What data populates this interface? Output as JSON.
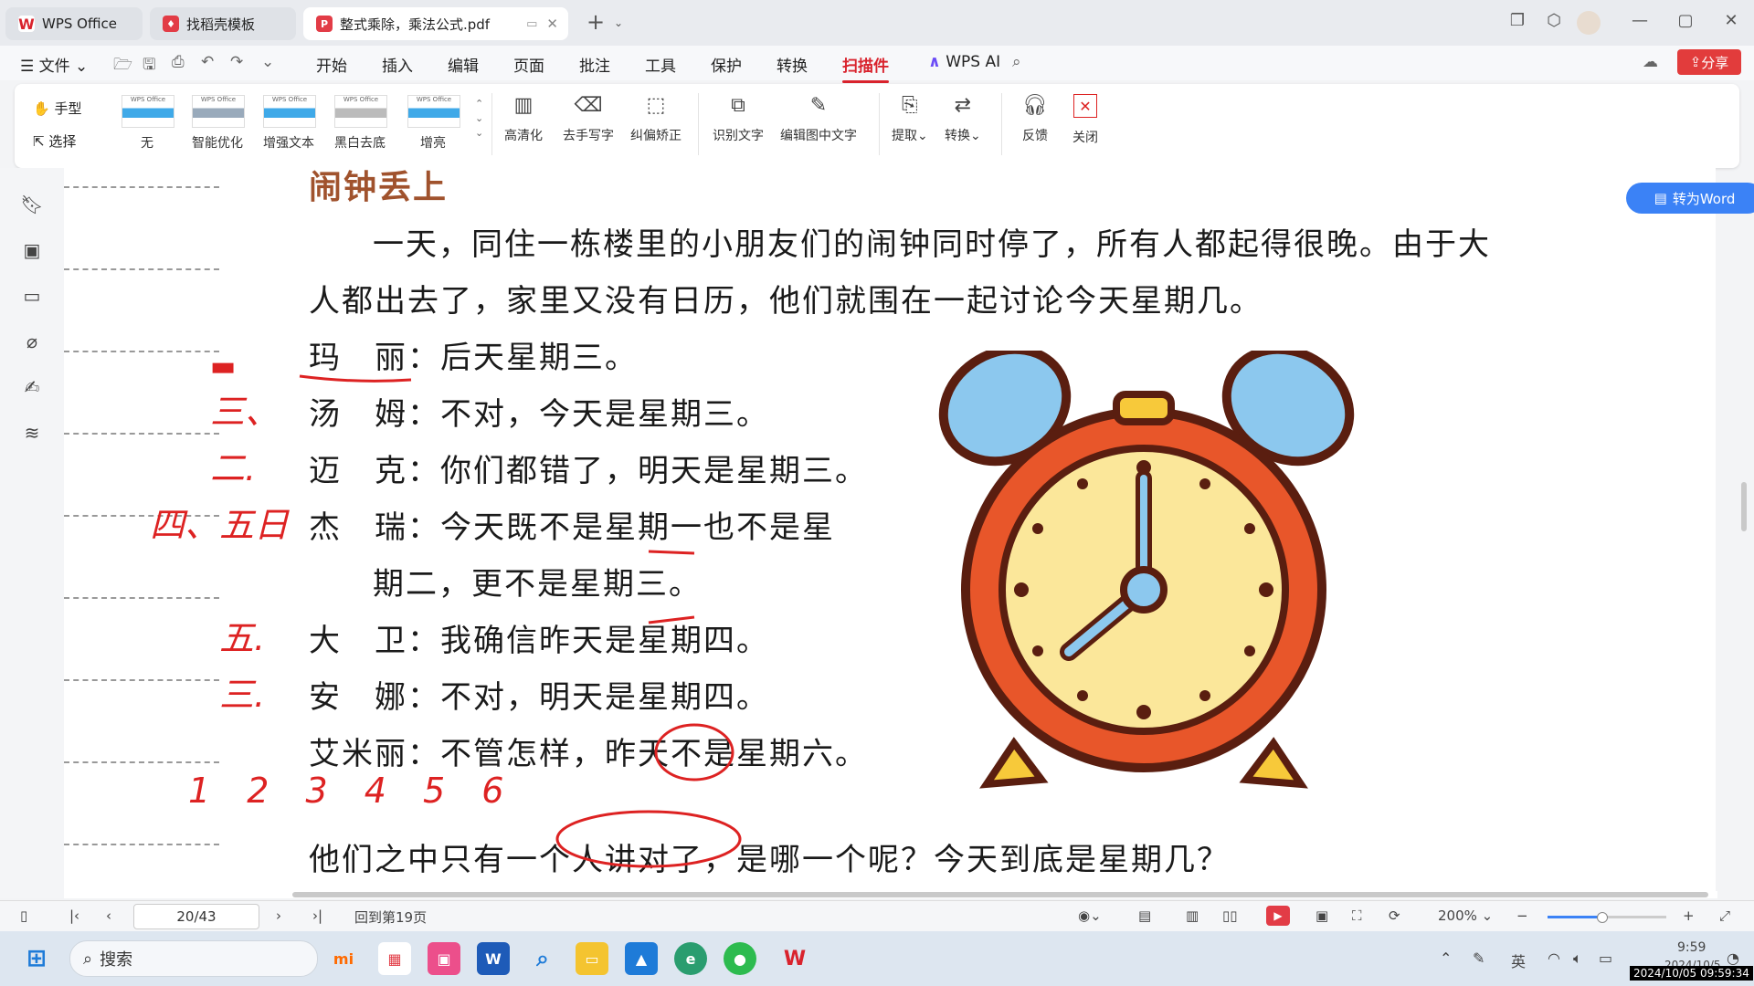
{
  "tabs": [
    {
      "label": "WPS Office",
      "icon": "wps-logo-icon",
      "color": "#d9232d"
    },
    {
      "label": "找稻壳模板",
      "icon": "docer-icon",
      "color": "#e23c46"
    },
    {
      "label": "整式乘除，乘法公式.pdf",
      "icon": "pdf-icon",
      "color": "#e23c46"
    }
  ],
  "menu": {
    "file": "文件",
    "items": [
      "开始",
      "插入",
      "编辑",
      "页面",
      "批注",
      "工具",
      "保护",
      "转换",
      "扫描件"
    ],
    "active": "扫描件",
    "ai": "WPS AI",
    "share": "分享"
  },
  "ribbon": {
    "hand": "手型",
    "select": "选择",
    "filters": [
      "无",
      "智能优化",
      "增强文本",
      "黑白去底",
      "增亮"
    ],
    "thumb_label": "WPS Office",
    "tools": [
      "高清化",
      "去手写字",
      "纠偏矫正",
      "识别文字",
      "编辑图中文字",
      "提取",
      "转换",
      "反馈",
      "关闭"
    ]
  },
  "convert_button": "转为Word",
  "document": {
    "title": "闹钟丢上",
    "para1_line1": "一天，同住一栋楼里的小朋友们的闹钟同时停了，所有人都起得很晚。由于大",
    "para1_line2": "人都出去了，家里又没有日历，他们就围在一起讨论今天星期几。",
    "lines": [
      "玛　丽：后天星期三。",
      "汤　姆：不对，今天是星期三。",
      "迈　克：你们都错了，明天是星期三。",
      "杰　瑞：今天既不是星期一也不是星",
      "期二，更不是星期三。",
      "大　卫：我确信昨天是星期四。",
      "安　娜：不对，明天是星期四。",
      "艾米丽：不管怎样，昨天不是星期六。"
    ],
    "question": "他们之中只有一个人讲对了，是哪一个呢？今天到底是星期几？"
  },
  "handwriting": [
    "三、",
    "二.",
    "四、五日",
    "五.",
    "三.",
    "1  2  3  4  5 6"
  ],
  "status": {
    "page": "20/43",
    "back_to": "回到第19页",
    "zoom": "200%",
    "zoom_level": 0.45
  },
  "taskbar": {
    "search_placeholder": "搜索",
    "time": "9:59",
    "date": "2024/10/5",
    "ime": "英",
    "watermark_stamp": "2024/10/05 09:59:34"
  }
}
